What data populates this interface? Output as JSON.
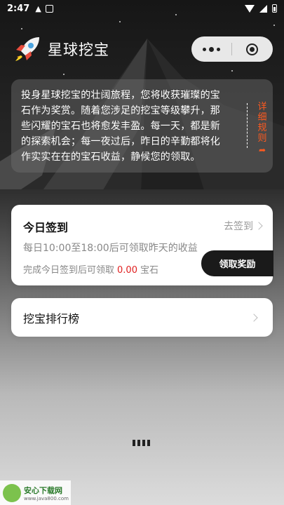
{
  "status_bar": {
    "time": "2:47",
    "icons": [
      "notification-icon",
      "gallery-icon",
      "wifi-icon",
      "signal-icon",
      "battery-icon"
    ]
  },
  "header": {
    "title": "星球挖宝",
    "logo_icon": "rocket-icon",
    "capsule": {
      "more_icon": "more-dots-icon",
      "close_icon": "record-close-icon"
    }
  },
  "intro": {
    "text": "投身星球挖宝的壮阔旅程，您将收获璀璨的宝石作为奖赏。随着您涉足的挖宝等级攀升，那些闪耀的宝石也将愈发丰盈。每一天，都是新的探索机会；每一夜过后，昨日的辛勤都将化作实实在在的宝石收益，静候您的领取。",
    "rules_link": "详细规则",
    "rules_icon": "arrow-share-icon"
  },
  "checkin": {
    "title": "今日签到",
    "status": "去签到",
    "desc": "每日10:00至18:00后可领取昨天的收益",
    "reward_prefix": "完成今日签到后可领取",
    "reward_value": "0.00",
    "reward_unit": "宝石",
    "claim_button": "领取奖励"
  },
  "ranking": {
    "label": "挖宝排行榜"
  },
  "watermark": {
    "title": "安心下载网",
    "url": "www.java800.com"
  },
  "colors": {
    "accent_orange": "#ff5a1f",
    "reward_red": "#e02020",
    "button_dark": "#1a1a1a"
  }
}
